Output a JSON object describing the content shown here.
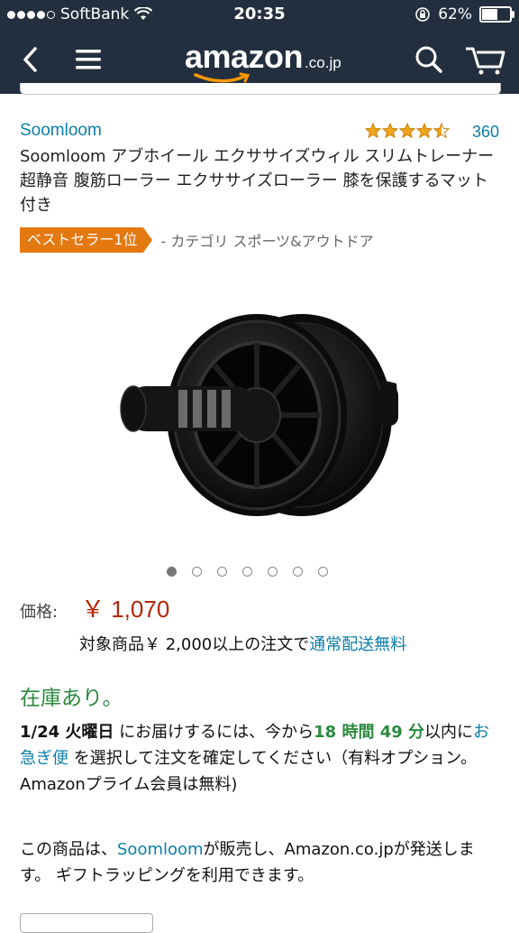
{
  "status_bar": {
    "carrier": "SoftBank",
    "time": "20:35",
    "battery": "62%",
    "battery_level": 0.62
  },
  "nav": {
    "logo_word": "amazon",
    "logo_tld": ".co.jp"
  },
  "product": {
    "brand": "Soomloom",
    "rating": 4.5,
    "review_count": "360",
    "title": "Soomloom アブホイール エクササイズウィル スリムトレーナー 超静音 腹筋ローラー エクササイズローラー 膝を保護するマット付き",
    "badge": "ベストセラー1位",
    "category": "- カテゴリ スポーツ&アウトドア",
    "image_count": 7,
    "current_image": 1,
    "price_label": "価格:",
    "price": "￥ 1,070",
    "shipping_prefix": "対象商品￥ 2,000以上の注文で",
    "shipping_link": "通常配送無料",
    "stock": "在庫あり。",
    "delivery": {
      "date": "1/24 火曜日",
      "text1": " にお届けするには、今から",
      "countdown": "18 時間 49 分",
      "text2": "以内に",
      "express_link": "お急ぎ便",
      "text3": " を選択して注文を確定してください（有料オプション。Amazonプライム会員は無料)"
    },
    "seller": {
      "text1": "この商品は、",
      "seller_link": "Soomloom",
      "text2": "が販売し、Amazon.co.jpが発送します。 ギフトラッピングを利用できます。"
    }
  },
  "colors": {
    "header_bg": "#232f3e",
    "link": "#0b7ea8",
    "price": "#b12704",
    "stock": "#2b8a3e",
    "badge": "#e47911",
    "star": "#f0a41b"
  }
}
